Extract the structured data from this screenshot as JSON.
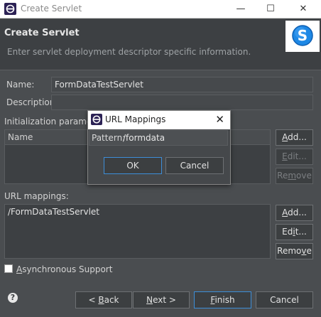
{
  "window": {
    "title": "Create Servlet",
    "controls": {
      "minimize": "—",
      "maximize": "☐",
      "close": "✕"
    }
  },
  "header": {
    "title": "Create Servlet",
    "description": "Enter servlet deployment descriptor specific information."
  },
  "form": {
    "name_label": "Name:",
    "name_value": "FormDataTestServlet",
    "description_label": "Description:",
    "description_value": "",
    "init_params_label": "Initialization paramete",
    "init_params_header": "Name",
    "url_mappings_label": "URL mappings:",
    "url_mappings": [
      "/FormDataTestServlet"
    ],
    "async_label_prefix": "A",
    "async_label_rest": "synchronous Support",
    "async_checked": false
  },
  "init_buttons": {
    "add": {
      "u": "A",
      "rest": "dd..."
    },
    "edit": {
      "u": "E",
      "rest": "dit..."
    },
    "remove": {
      "pre": "Re",
      "u": "m",
      "rest": "ove"
    }
  },
  "url_buttons": {
    "add": {
      "u": "A",
      "rest": "dd..."
    },
    "edit": {
      "pre": "Ed",
      "u": "i",
      "rest": "t..."
    },
    "remove": {
      "pre": "Remo",
      "u": "v",
      "rest": "e"
    }
  },
  "footer": {
    "help": "?",
    "back": {
      "pre": "< ",
      "u": "B",
      "rest": "ack"
    },
    "next": {
      "u": "N",
      "rest": "ext >"
    },
    "finish": {
      "u": "F",
      "rest": "inish"
    },
    "cancel": "Cancel"
  },
  "dialog": {
    "title": "URL Mappings",
    "close": "✕",
    "pattern_label": "Pattern:",
    "pattern_value": "/formdata",
    "ok": "OK",
    "cancel": "Cancel"
  },
  "colors": {
    "background": "#4a4d50",
    "accent_blue": "#3d8ed8",
    "logo_blue": "#1e88e5"
  }
}
